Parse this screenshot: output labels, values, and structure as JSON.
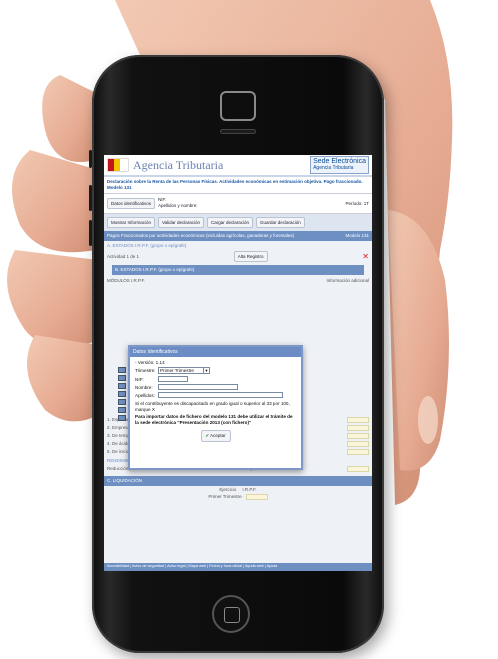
{
  "header": {
    "agency": "Agencia Tributaria",
    "sede_line1": "Sede Electrónica",
    "sede_line2": "Agencia Tributaria"
  },
  "form_title": "Declaración sobre la Renta de las Personas Físicas. Actividades económicas en estimación objetiva. Pago fraccionado. Modelo 131",
  "id_bar": {
    "button": "Datos identificativos",
    "nif_label": "NIF:",
    "name_label": "Apellidos y nombre:",
    "period_label": "Período: 1T"
  },
  "toolbar": {
    "show_info": "Mostrar Información",
    "validate": "Validar declaración",
    "load": "Cargar declaración",
    "save": "Guardar declaración"
  },
  "banner": "Pagos Fraccionados por actividades económicas (incluidas agrícolas, ganaderas y forestales)",
  "banner_right": "Modelo 131",
  "sections": {
    "a": "A. ESTADOS I.R.P.F. (grupo o epígrafe)",
    "activity": "Actividad 1 de 1",
    "alta": "Alta Registro",
    "b": "B. ESTADOS I.R.P.F. (grupo o epígrafe)",
    "modulos": "MÓDULOS I.R.P.F.",
    "info": "Información adicional"
  },
  "rows": [
    "1. Especiales",
    "2. Empresas de pequeña dimensión",
    "3. De temporada",
    "4. De ácido",
    "5. De inicio de nueva actividad"
  ],
  "rendimiento": "RENDIMIENTO A EFECTOS DE PAGOS FRACCIONADOS (*)",
  "reduccion": "Reducción para actividades económicas realizadas en el término municipal de Lorca",
  "liquidacion": "C. LIQUIDACIÓN",
  "ejercicio": "Ejercicio",
  "irpf": "I.R.P.F.",
  "trimestre_footer": "Primer Trimestre",
  "dialog": {
    "title": "Datos Identificativos",
    "version": "- Versión: 1.14",
    "trimestre_label": "Trimestre:",
    "trimestre_value": "Primer Trimestre",
    "nif_label": "NIF:",
    "nombre_label": "Nombre:",
    "apellidos_label": "Apellidos:",
    "disability_note": "Si el contribuyente es discapacitado en grado igual o superior al 33 por 100, marque X",
    "import_note": "Para importar datos de fichero del modelo 131 debe utilizar el trámite de la sede electrónica \"Presentación 2013 (con fichero)\"",
    "accept": "Aceptar"
  },
  "footer": "Accesibilidad | Aviso de seguridad | Aviso legal | Mapa web | Fecha y hora oficial | Ayuda web | Ayuda"
}
